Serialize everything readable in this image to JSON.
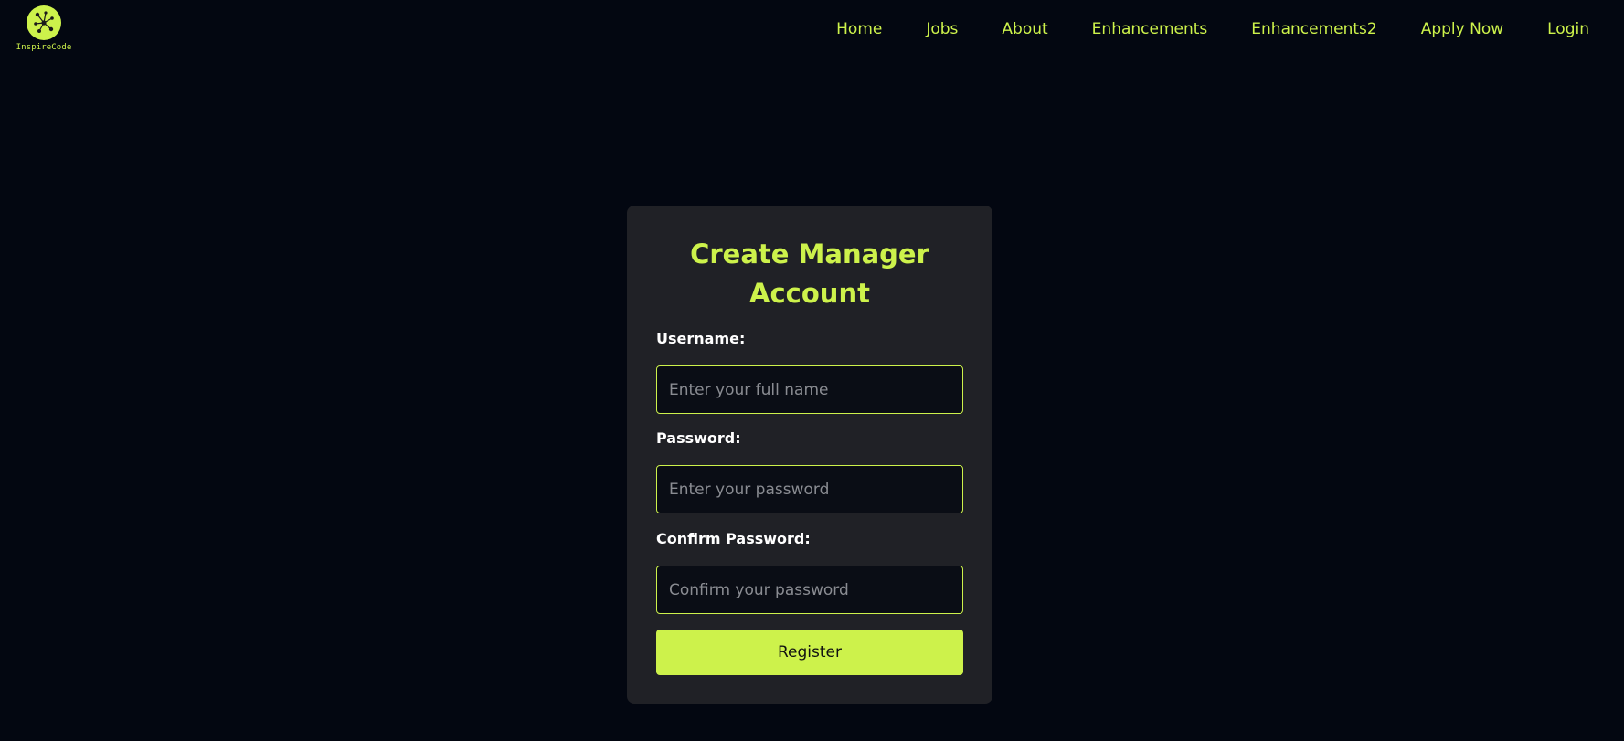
{
  "brand": {
    "logo_text": "InspireCode",
    "accent_color": "#cdf24b",
    "logo_icon": "network-nodes-icon"
  },
  "nav": {
    "items": [
      {
        "label": "Home"
      },
      {
        "label": "Jobs"
      },
      {
        "label": "About"
      },
      {
        "label": "Enhancements"
      },
      {
        "label": "Enhancements2"
      },
      {
        "label": "Apply Now"
      },
      {
        "label": "Login"
      }
    ]
  },
  "form": {
    "title": "Create Manager Account",
    "username": {
      "label": "Username:",
      "placeholder": "Enter your full name",
      "value": ""
    },
    "password": {
      "label": "Password:",
      "placeholder": "Enter your password",
      "value": ""
    },
    "confirm": {
      "label": "Confirm Password:",
      "placeholder": "Confirm your password",
      "value": ""
    },
    "submit_label": "Register"
  },
  "colors": {
    "background": "#030711",
    "card": "#202126",
    "accent": "#cdf24b"
  }
}
